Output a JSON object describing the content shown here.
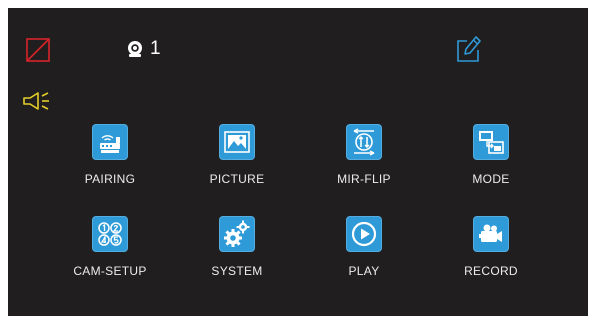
{
  "status_bar": {
    "camera_number": "1",
    "icons": [
      "no-signal-icon",
      "camera-dot-icon",
      "edit-icon",
      "speaker-icon"
    ]
  },
  "menu": {
    "items": [
      {
        "label": "PAIRING",
        "icon": "pairing-icon"
      },
      {
        "label": "PICTURE",
        "icon": "picture-icon"
      },
      {
        "label": "MIR-FLIP",
        "icon": "mirror-flip-icon"
      },
      {
        "label": "MODE",
        "icon": "mode-icon"
      },
      {
        "label": "CAM-SETUP",
        "icon": "cam-setup-icon"
      },
      {
        "label": "SYSTEM",
        "icon": "system-gear-icon"
      },
      {
        "label": "PLAY",
        "icon": "play-icon"
      },
      {
        "label": "RECORD",
        "icon": "record-camera-icon"
      }
    ]
  },
  "colors": {
    "background": "#201e1e",
    "tile": "#2f9ad8",
    "accent_red": "#d8232a",
    "accent_yellow": "#e6cf28",
    "accent_blue": "#2f9ad8",
    "text": "#ececec"
  }
}
